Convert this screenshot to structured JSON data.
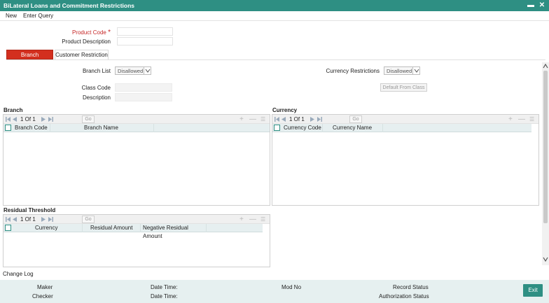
{
  "window": {
    "title": "BiLateral Loans and Commitment Restrictions"
  },
  "menu": {
    "new": "New",
    "enter_query": "Enter Query"
  },
  "form": {
    "product_code_label": "Product Code",
    "required_mark": "*",
    "product_description_label": "Product Description"
  },
  "tabs": {
    "branch_restriction": "Branch Restriction",
    "customer_restriction": "Customer Restriction"
  },
  "branch_list": {
    "label": "Branch List",
    "value": "Disallowed"
  },
  "currency_restrictions": {
    "label": "Currency Restrictions",
    "value": "Disallowed"
  },
  "class": {
    "code_label": "Class Code",
    "description_label": "Description",
    "default_button": "Default From Class"
  },
  "branch": {
    "title": "Branch",
    "pager": "1 Of 1",
    "go": "Go",
    "columns": [
      "Branch Code",
      "Branch Name"
    ]
  },
  "currency": {
    "title": "Currency",
    "pager": "1 Of 1",
    "go": "Go",
    "columns": [
      "Currency Code",
      "Currency Name"
    ]
  },
  "residual": {
    "title": "Residual Threshold",
    "pager": "1 Of 1",
    "go": "Go",
    "columns": [
      "Currency",
      "Residual Amount",
      "Negative Residual Amount"
    ]
  },
  "change_log": "Change Log",
  "footer": {
    "maker": "Maker",
    "checker": "Checker",
    "date_time_1": "Date Time:",
    "date_time_2": "Date Time:",
    "mod_no": "Mod No",
    "record_status": "Record Status",
    "authorization_status": "Authorization Status",
    "exit": "Exit"
  },
  "tools": {
    "add": "+",
    "remove": "—",
    "list": "☰"
  },
  "colors": {
    "title_bar": "#2e8f83",
    "active_tab": "#d32f1e",
    "footer": "#e6f0f0"
  }
}
